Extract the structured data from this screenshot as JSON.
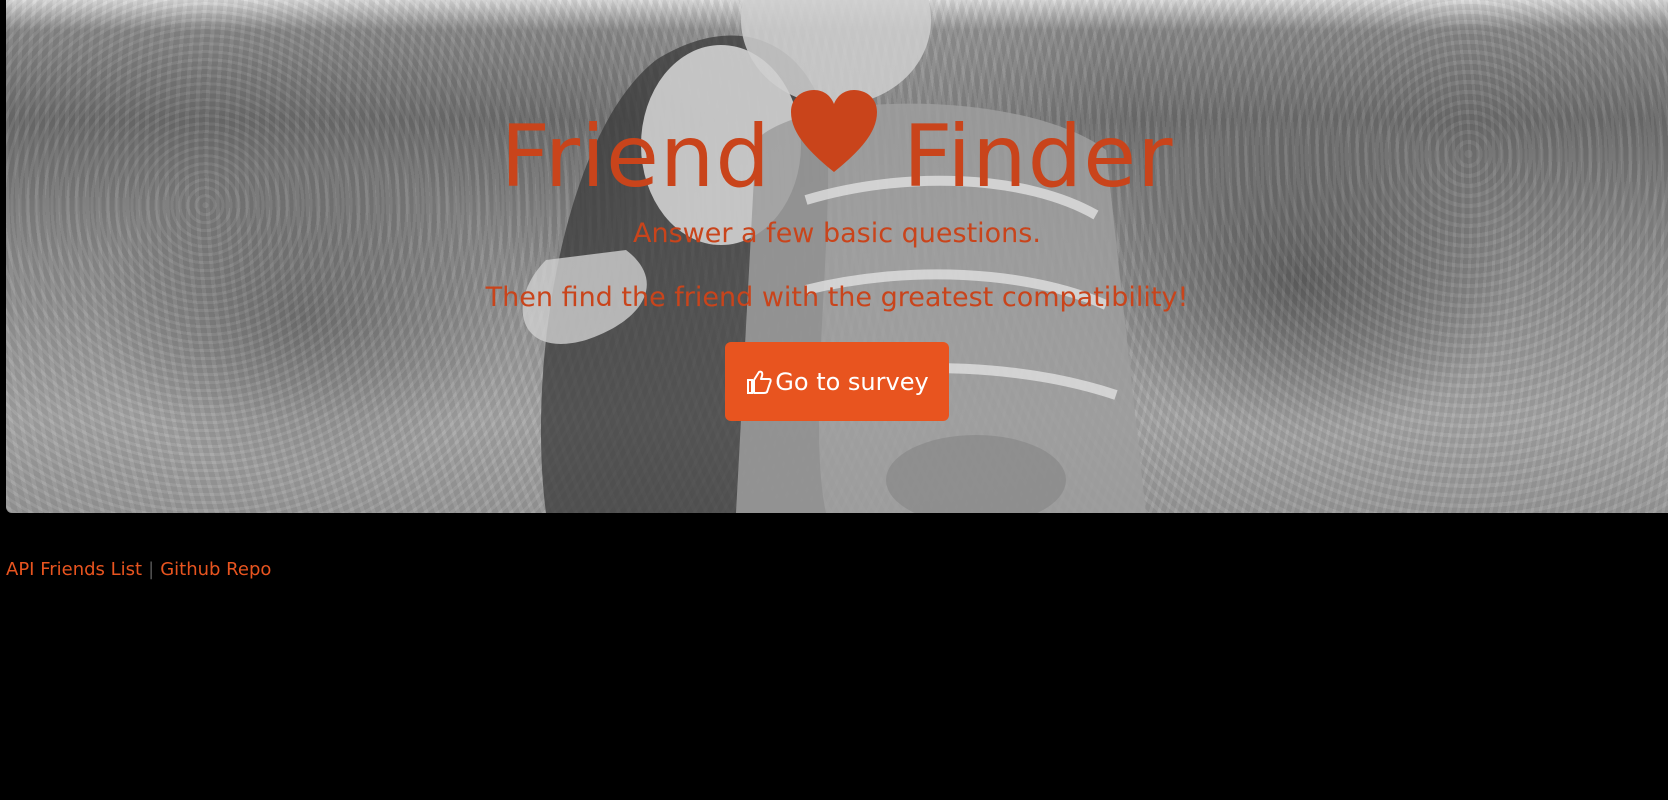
{
  "hero": {
    "title_left": "Friend",
    "title_right": "Finder",
    "heart_icon": "heart-icon",
    "subtitle_1": "Answer a few basic questions.",
    "subtitle_2": "Then find the friend with the greatest compatibility!",
    "button_label": "Go to survey",
    "button_icon": "thumbs-up-icon"
  },
  "footer": {
    "link_api": "API Friends List",
    "separator": "|",
    "link_repo": "Github Repo"
  },
  "colors": {
    "accent": "#e8541f",
    "title": "#c9441b",
    "background": "#000000"
  }
}
